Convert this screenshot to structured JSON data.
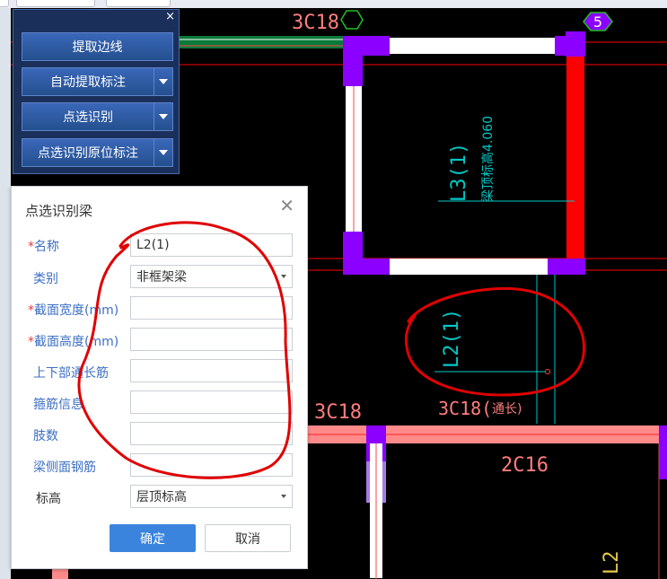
{
  "tool_panel": {
    "buttons": [
      {
        "label": "提取边线",
        "has_dropdown": false
      },
      {
        "label": "自动提取标注",
        "has_dropdown": true
      },
      {
        "label": "点选识别",
        "has_dropdown": true
      },
      {
        "label": "点选识别原位标注",
        "has_dropdown": true
      }
    ],
    "close": "×"
  },
  "dialog": {
    "title": "点选识别梁",
    "close": "✕",
    "fields": [
      {
        "label": "名称",
        "required": true,
        "value": "L2(1)",
        "type": "text"
      },
      {
        "label": "类别",
        "required": false,
        "value": "非框架梁",
        "type": "select"
      },
      {
        "label": "截面宽度(mm)",
        "required": true,
        "value": "",
        "type": "text"
      },
      {
        "label": "截面高度(mm)",
        "required": true,
        "value": "",
        "type": "text"
      },
      {
        "label": "上下部通长筋",
        "required": false,
        "value": "",
        "type": "text"
      },
      {
        "label": "箍筋信息",
        "required": false,
        "value": "",
        "type": "text"
      },
      {
        "label": "肢数",
        "required": false,
        "value": "",
        "type": "text"
      },
      {
        "label": "梁侧面钢筋",
        "required": false,
        "value": "",
        "type": "text"
      },
      {
        "label": "标高",
        "required": false,
        "value": "层顶标高",
        "type": "select",
        "plain": true
      }
    ],
    "ok_label": "确定",
    "cancel_label": "取消",
    "required_mark": "*"
  },
  "cad": {
    "labels": {
      "top_rebar": "3C18",
      "axis_number": "5",
      "beam_l3": "L3(1)",
      "beam_l3_note": "梁顶标高4.060",
      "beam_l2": "L2(1)",
      "rebar_left": "3C18",
      "rebar_mid": "3C18(",
      "rebar_mid_suffix": "通长)",
      "rebar_right": "2C16",
      "beam_bottom_right": "L2"
    },
    "colors": {
      "background": "#000000",
      "beam_fill": "#ffffff",
      "column": "#8b00ff",
      "red": "#ff0000",
      "green_text": "#00c8c8",
      "pink_text": "#ff7d7d",
      "yellow_text": "#e6c84b"
    }
  },
  "colors": {
    "panel_bg": "#1a2f5a",
    "ok_button": "#3a84de",
    "label_blue": "#3d6fc2",
    "annotation_red": "#e00000"
  }
}
